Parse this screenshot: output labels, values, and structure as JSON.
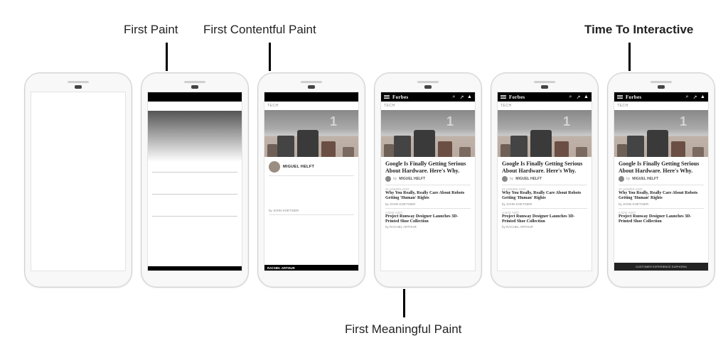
{
  "labels": {
    "first_paint": "First Paint",
    "first_contentful_paint": "First Contentful Paint",
    "first_meaningful_paint": "First Meaningful Paint",
    "time_to_interactive": "Time To Interactive"
  },
  "site": {
    "brand": "Forbes",
    "section": "TECH",
    "hero_number": "1",
    "headline": "Google Is Finally Getting Serious About Hardware. Here's Why.",
    "byline_prefix": "by",
    "byline_author": "MIGUEL HELFT",
    "stories": [
      {
        "age": "21 HOURS AGO",
        "title": "Why You Really, Really Care About Robots Getting 'Human' Rights",
        "author": "by JOHN KOETSIER"
      },
      {
        "age": "A DAY AGO",
        "title": "Project Runway Designer Launches 3D-Printed Shoe Collection",
        "author": "by RACHEL ARTHUR"
      }
    ],
    "fcp_author": "MIGUEL HELFT",
    "fcp_footer_author": "by JOHN KOETSIER",
    "fcp_footer_author2": "RACHEL ARTHUR",
    "promo_text": "CUSTOMER EXPERIENCE EUPHORIA"
  }
}
